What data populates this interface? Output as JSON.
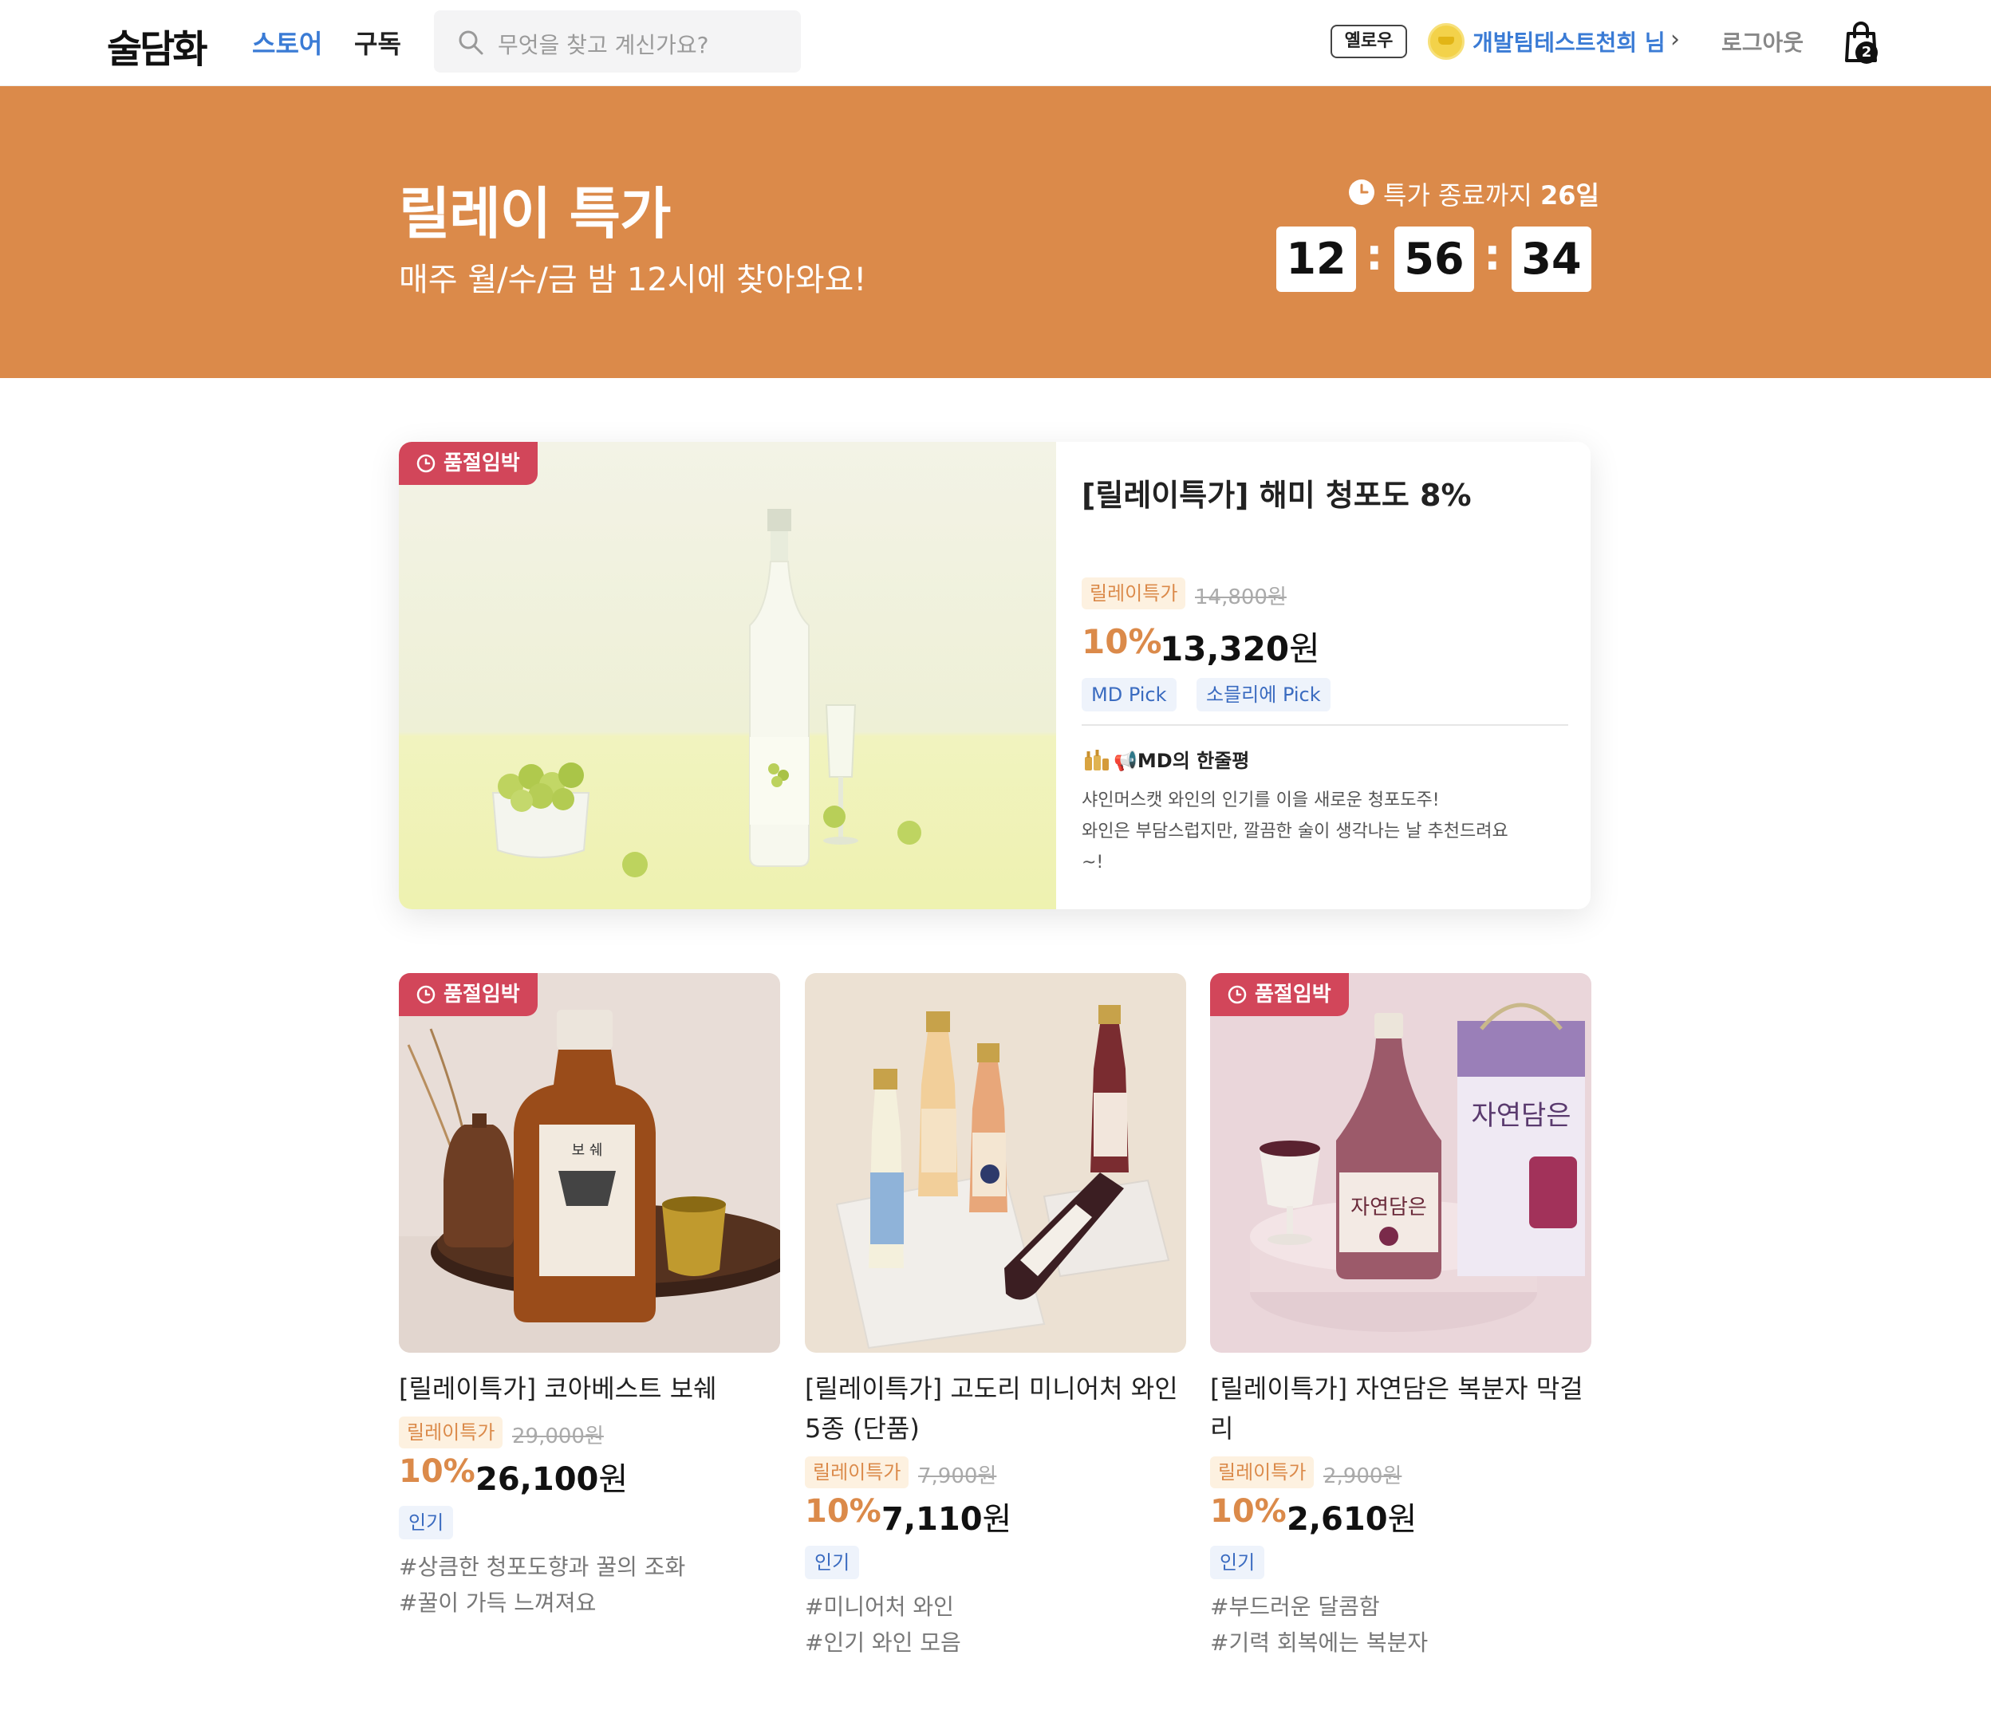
{
  "header": {
    "logo": "술담화",
    "nav": [
      "스토어",
      "구독"
    ],
    "search_placeholder": "무엇을 찾고 계신가요?",
    "membership_badge": "옐로우",
    "user_name": "개발팀테스트천희 님",
    "logout": "로그아웃",
    "cart_count": "2"
  },
  "banner": {
    "title": "릴레이 특가",
    "subtitle": "매주 월/수/금 밤 12시에 찾아와요!",
    "countdown_prefix": "특가 종료까지",
    "countdown_days": "26일",
    "hours": "12",
    "minutes": "56",
    "seconds": "34",
    "separator": ":",
    "background_color": "#db8a4a"
  },
  "featured": {
    "badge": "품절임박",
    "title": "[릴레이특가] 해미 청포도 8%",
    "tag": "릴레이특가",
    "original_price": "14,800원",
    "discount": "10%",
    "price": "13,320",
    "price_unit": "원",
    "picks": [
      "MD Pick",
      "소믈리에 Pick"
    ],
    "md_heading": "📢MD의 한줄평",
    "md_lines": [
      "샤인머스캣 와인의 인기를 이을 새로운 청포도주!",
      "와인은 부담스럽지만, 깔끔한 술이 생각나는 날 추천드려요",
      "~!"
    ]
  },
  "products": [
    {
      "badge": "품절임박",
      "title": "[릴레이특가] 코아베스트 보쉐",
      "tag": "릴레이특가",
      "original_price": "29,000원",
      "discount": "10%",
      "price": "26,100",
      "price_unit": "원",
      "label": "인기",
      "hashtags": [
        "#상큼한 청포도향과 꿀의 조화",
        "#꿀이 가득 느껴져요"
      ]
    },
    {
      "badge": "",
      "title": "[릴레이특가] 고도리 미니어처 와인 5종 (단품)",
      "tag": "릴레이특가",
      "original_price": "7,900원",
      "discount": "10%",
      "price": "7,110",
      "price_unit": "원",
      "label": "인기",
      "hashtags": [
        "#미니어처 와인",
        "#인기 와인 모음"
      ]
    },
    {
      "badge": "품절임박",
      "title": "[릴레이특가] 자연담은 복분자 막걸리",
      "tag": "릴레이특가",
      "original_price": "2,900원",
      "discount": "10%",
      "price": "2,610",
      "price_unit": "원",
      "label": "인기",
      "hashtags": [
        "#부드러운 달콤함",
        "#기력 회복에는 복분자"
      ]
    }
  ],
  "colors": {
    "accent_blue": "#3a7bd5",
    "accent_orange": "#db8a4a",
    "sold_out_red": "#d2465a"
  }
}
